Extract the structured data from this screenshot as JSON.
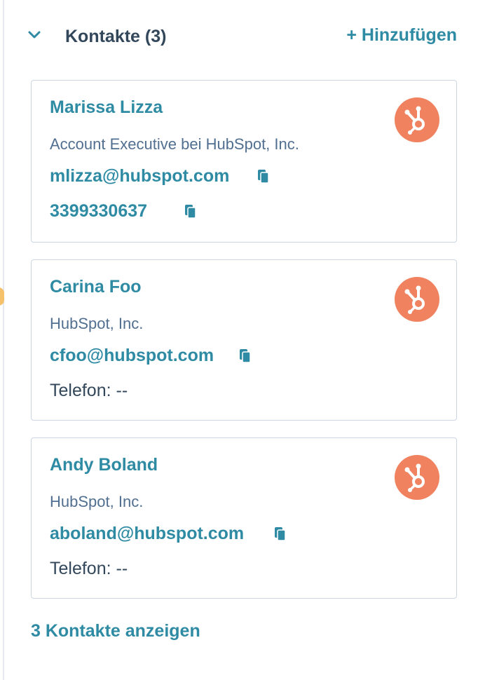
{
  "section": {
    "title": "Kontakte (3)",
    "add_label": "+ Hinzufügen",
    "view_all_label": "3 Kontakte anzeigen"
  },
  "contacts": [
    {
      "name": "Marissa Lizza",
      "subtitle": "Account Executive bei HubSpot, Inc.",
      "email": "mlizza@hubspot.com",
      "phone": "3399330637"
    },
    {
      "name": "Carina Foo",
      "subtitle": "HubSpot, Inc.",
      "email": "cfoo@hubspot.com",
      "phone_text": "Telefon: --"
    },
    {
      "name": "Andy Boland",
      "subtitle": "HubSpot, Inc.",
      "email": "aboland@hubspot.com",
      "phone_text": "Telefon: --"
    }
  ],
  "icons": {
    "chevron": "chevron-down-icon",
    "copy": "copy-icon",
    "brand": "hubspot-sprocket-icon"
  },
  "colors": {
    "link": "#2e8ba3",
    "heading": "#33475b",
    "muted": "#516f90",
    "border": "#cbd6e2",
    "brand_orange": "#f0825f"
  }
}
